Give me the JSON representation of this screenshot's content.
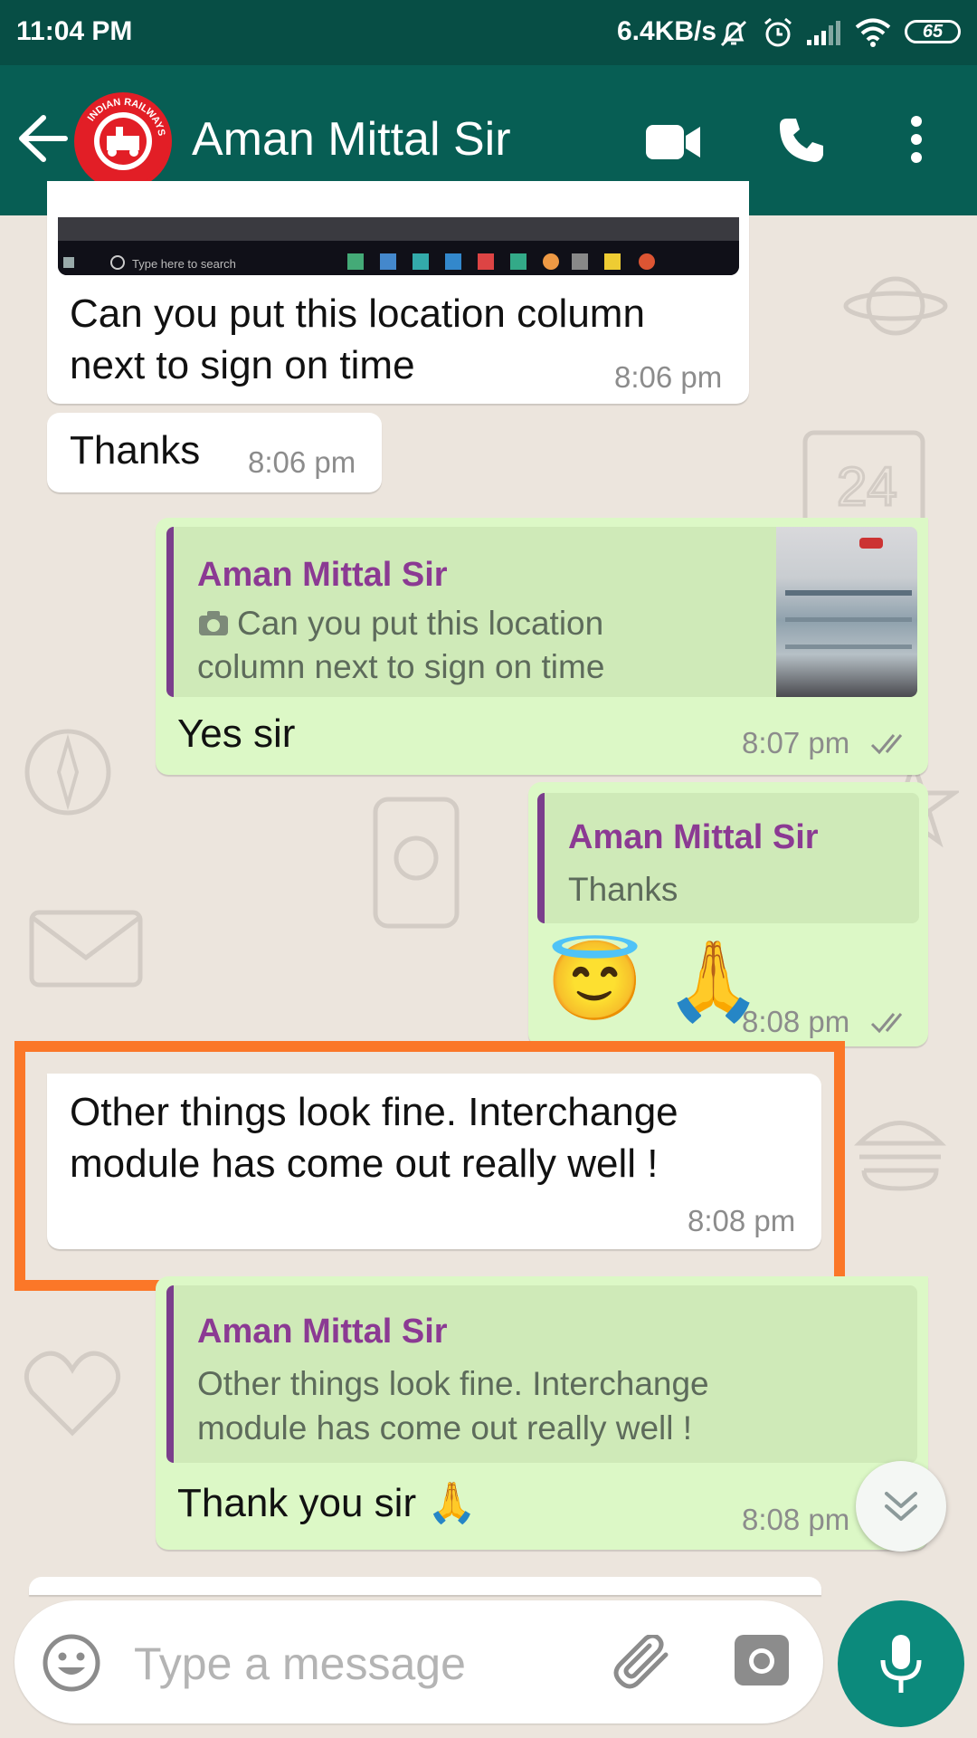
{
  "status_bar": {
    "time": "11:04 PM",
    "network_rate": "6.4KB/s",
    "battery": "65"
  },
  "header": {
    "contact_name": "Aman Mittal Sir",
    "avatar_text": "INDIAN RAILWAYS"
  },
  "messages": [
    {
      "direction": "incoming",
      "text": "Can you put this location column next to sign on time",
      "line1": "Can you put this location column",
      "line2": "next to sign on time",
      "time": "8:06 pm",
      "has_image": true,
      "image_caption": "Type here to search"
    },
    {
      "direction": "incoming",
      "text": "Thanks",
      "time": "8:06 pm"
    },
    {
      "direction": "outgoing",
      "quote_name": "Aman Mittal Sir",
      "quote_line1": "Can you put this location",
      "quote_line2": "column next to sign on time",
      "quote_icon": "camera-icon",
      "text": "Yes sir",
      "time": "8:07 pm",
      "status": "read"
    },
    {
      "direction": "outgoing",
      "quote_name": "Aman Mittal Sir",
      "quote_text": "Thanks",
      "text": "😇 🙏",
      "time": "8:08 pm",
      "status": "read"
    },
    {
      "direction": "incoming",
      "line1": "Other things look fine. Interchange",
      "line2": "module has come out really well !",
      "time": "8:08 pm",
      "highlighted": true
    },
    {
      "direction": "outgoing",
      "quote_name": "Aman Mittal Sir",
      "quote_line1": "Other things look fine. Interchange",
      "quote_line2": "module has come out really well !",
      "text": "Thank you sir 🙏",
      "time": "8:08 pm",
      "status": "read"
    }
  ],
  "composer": {
    "placeholder": "Type a message"
  },
  "colors": {
    "header": "#075e54",
    "status_bar": "#074e45",
    "outgoing_bubble": "#dcf8c6",
    "incoming_bubble": "#ffffff",
    "chat_bg": "#ece5dd",
    "quote_bar": "#7a3e8c",
    "quote_name": "#8b3a93",
    "highlight_box": "#fb7728",
    "mic_button": "#0c8a7c",
    "read_ticks": "#8c8c8c"
  }
}
